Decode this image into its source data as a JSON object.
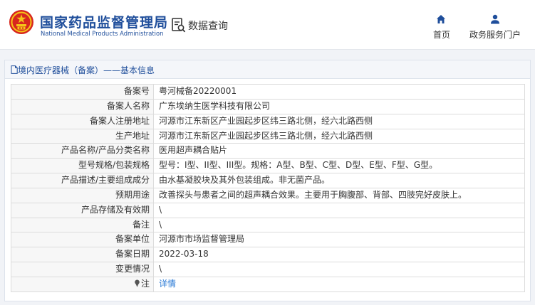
{
  "header": {
    "brand_cn": "国家药品监督管理局",
    "brand_en": "National Medical Products Administration",
    "query_label": "数据查询",
    "nav": [
      {
        "label": "首页",
        "icon": "home-icon"
      },
      {
        "label": "政务服务门户",
        "icon": "user-icon"
      }
    ]
  },
  "panel": {
    "title": "境内医疗器械（备案）——基本信息",
    "icon": "document-icon"
  },
  "rows": [
    {
      "label": "备案号",
      "value": "粤河械备20220001"
    },
    {
      "label": "备案人名称",
      "value": "广东埃纳生医学科技有限公司"
    },
    {
      "label": "备案人注册地址",
      "value": "河源市江东新区产业园起步区纬三路北侧，经六北路西侧"
    },
    {
      "label": "生产地址",
      "value": "河源市江东新区产业园起步区纬三路北侧，经六北路西侧"
    },
    {
      "label": "产品名称/产品分类名称",
      "value": "医用超声耦合贴片"
    },
    {
      "label": "型号规格/包装规格",
      "value": "型号：I型、II型、III型。规格：A型、B型、C型、D型、E型、F型、G型。"
    },
    {
      "label": "产品描述/主要组成成分",
      "value": "由水基凝胶块及其外包装组成。非无菌产品。"
    },
    {
      "label": "预期用途",
      "value": "改善探头与患者之间的超声耦合效果。主要用于胸腹部、背部、四肢完好皮肤上。"
    },
    {
      "label": "产品存储及有效期",
      "value": "\\"
    },
    {
      "label": "备注",
      "value": "\\"
    },
    {
      "label": "备案单位",
      "value": "河源市市场监督管理局"
    },
    {
      "label": "备案日期",
      "value": "2022-03-18"
    },
    {
      "label": "变更情况",
      "value": "\\"
    }
  ],
  "note_row": {
    "label": "注",
    "link": "详情",
    "icon": "pin-icon"
  },
  "colors": {
    "brand_blue": "#1f4e9b",
    "link_blue": "#2b7bd6",
    "label_bg": "#f7f7f7",
    "emblem_red": "#d7261e",
    "emblem_gold": "#f5c518"
  }
}
